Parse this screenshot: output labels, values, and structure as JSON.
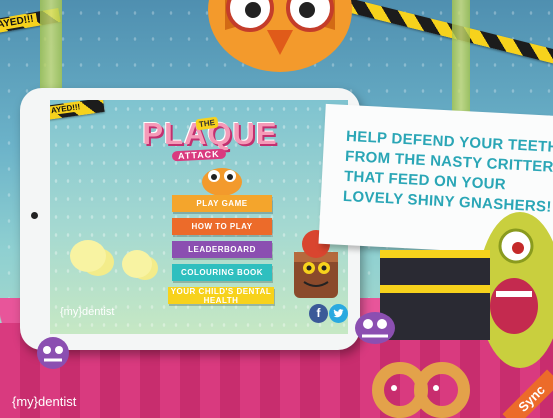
{
  "tape": {
    "text": "AYED!!!"
  },
  "tablet": {
    "logo": {
      "the": "THE",
      "plaque": "PLAQUE",
      "attack": "ATTACK"
    },
    "menu": [
      {
        "label": "PLAY GAME"
      },
      {
        "label": "HOW TO PLAY"
      },
      {
        "label": "LEADERBOARD"
      },
      {
        "label": "COLOURING BOOK"
      },
      {
        "label": "YOUR CHILD'S DENTAL HEALTH"
      }
    ],
    "tape_text": "AYED!!!",
    "brand": "{my}dentist",
    "facebook_icon": "f",
    "twitter_icon": "🐦"
  },
  "speech": {
    "text": "HELP DEFEND YOUR TEETH FROM THE NASTY CRITTERS THAT FEED ON YOUR LOVELY SHINY GNASHERS!"
  },
  "footer": {
    "brand": "{my}dentist",
    "badge": "Sync"
  },
  "colors": {
    "pink": "#d93a7f",
    "orange": "#ec6b2a",
    "teal": "#2aa6b6",
    "yellow": "#f7d21c",
    "purple": "#8b4fb1"
  }
}
